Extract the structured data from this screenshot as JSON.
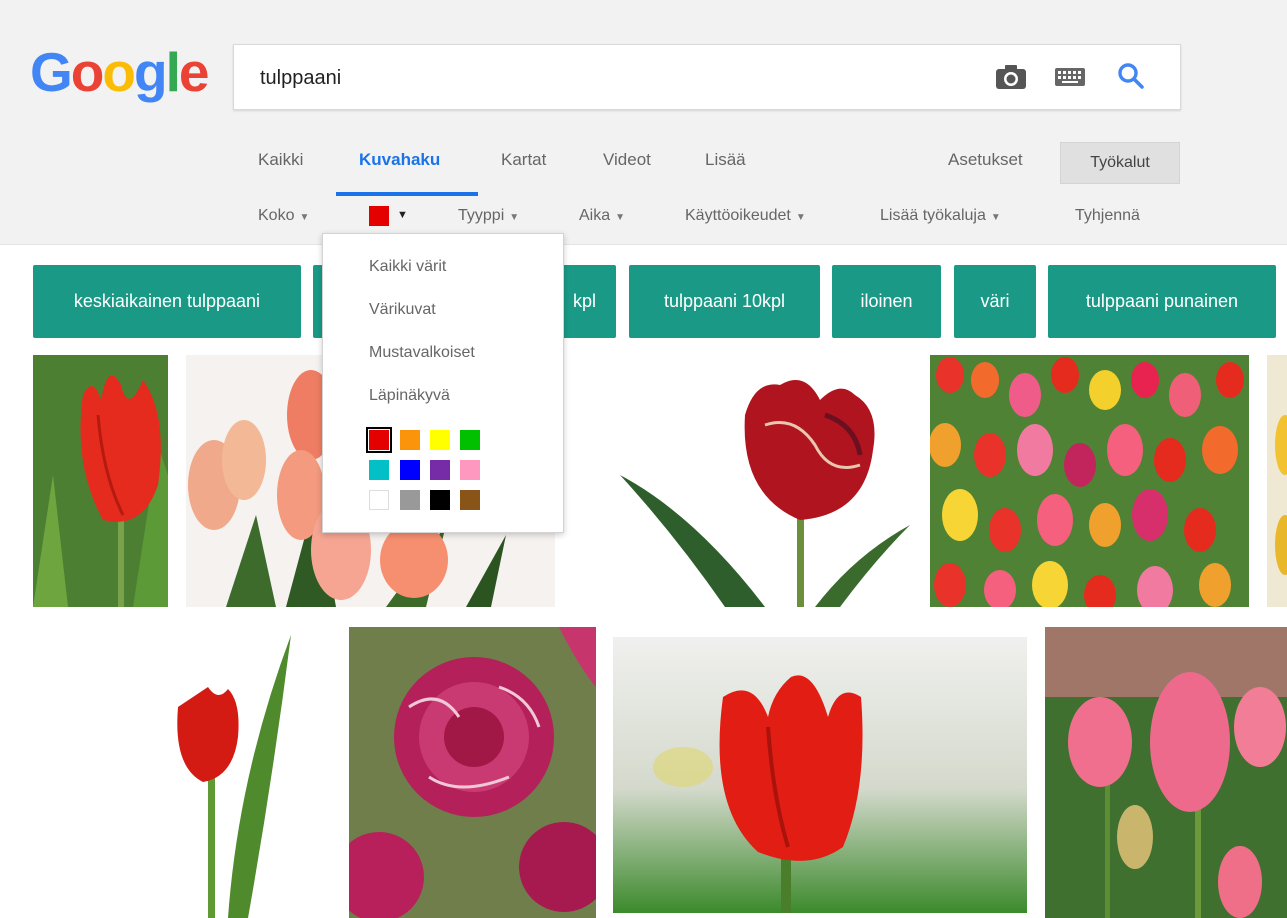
{
  "logo": {
    "letters": [
      "G",
      "o",
      "o",
      "g",
      "l",
      "e"
    ]
  },
  "search": {
    "value": "tulppaani"
  },
  "icons": {
    "camera": "camera-icon",
    "keyboard": "keyboard-icon",
    "search": "search-icon"
  },
  "nav": {
    "items": [
      "Kaikki",
      "Kuvahaku",
      "Kartat",
      "Videot",
      "Lisää"
    ],
    "settings": "Asetukset",
    "tools": "Työkalut"
  },
  "tools_row": {
    "size": "Koko",
    "type": "Tyyppi",
    "time": "Aika",
    "usage": "Käyttöoikeudet",
    "more": "Lisää työkaluja",
    "clear": "Tyhjennä",
    "selected_color": "#e50000"
  },
  "chips": [
    "keskiaikainen tulppaani",
    "tulppaani 10kpl",
    "iloinen",
    "väri",
    "tulppaani punainen"
  ],
  "chip_hidden_fragment": "kpl",
  "color_menu": {
    "options": [
      "Kaikki värit",
      "Värikuvat",
      "Mustavalkoiset",
      "Läpinäkyvä"
    ],
    "colors": [
      "#e50000",
      "#fb940b",
      "#ffff00",
      "#00c000",
      "#03c0c6",
      "#0000ff",
      "#762ca7",
      "#ff98bf",
      "#ffffff",
      "#999999",
      "#000000",
      "#885418"
    ],
    "selected": "#e50000"
  },
  "colors": {
    "accent": "#1a73e8",
    "chip": "#1a9a86"
  }
}
